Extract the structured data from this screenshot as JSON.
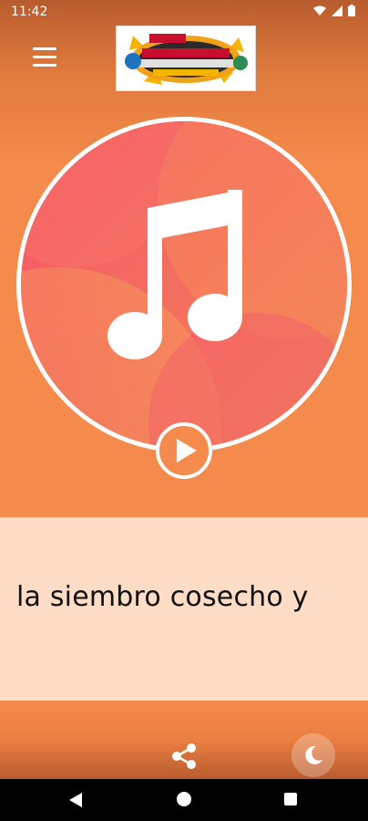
{
  "status_bar": {
    "time": "11:42",
    "icons": [
      "wifi-icon",
      "signal-icon",
      "battery-icon"
    ]
  },
  "header": {
    "menu_icon": "hamburger-menu-icon",
    "logo": "station-logo"
  },
  "player": {
    "artwork_icon": "music-note-icon",
    "play_icon": "play-icon",
    "lyrics_text": "la siembro cosecho y"
  },
  "bottom_bar": {
    "share_icon": "share-icon",
    "night_mode_icon": "moon-icon"
  },
  "navigation": {
    "back_icon": "back-icon",
    "home_icon": "home-icon",
    "recents_icon": "recents-icon"
  },
  "colors": {
    "background": "#F48A4B",
    "lyrics_panel": "#FEDCC6",
    "artwork": "#F2735B",
    "accent_pink": "#F6536A"
  }
}
